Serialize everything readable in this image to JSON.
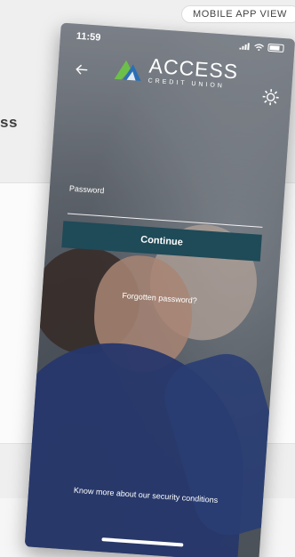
{
  "page_tag": "MOBILE APP VIEW",
  "background": {
    "title_fragment": "ss"
  },
  "phone": {
    "status": {
      "time": "11:59"
    },
    "header": {
      "back_icon": "arrow-left-icon",
      "settings_icon": "gear-icon",
      "logo_main": "ACCESS",
      "logo_sub": "CREDIT UNION"
    },
    "form": {
      "password_label": "Password",
      "password_value": "",
      "continue_label": "Continue",
      "forgot_label": "Forgotten password?"
    },
    "footer": {
      "security_link": "Know more about our security conditions"
    }
  },
  "colors": {
    "button": "#1f4a58",
    "text": "#ffffff",
    "logo_green": "#6cc04a",
    "logo_blue": "#2a6fb5"
  }
}
